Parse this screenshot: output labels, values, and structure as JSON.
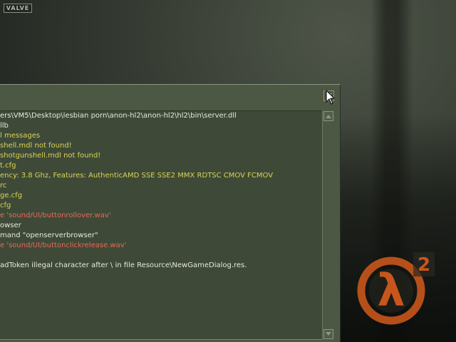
{
  "branding": {
    "valve_text": "VALVE"
  },
  "colors": {
    "white": "#e7e8df",
    "yellow": "#d8d356",
    "red": "#e46a5a",
    "logo_orange": "#c8561c"
  },
  "console": {
    "lines": [
      {
        "text": "ers\\VM5\\Desktop\\lesbian porn\\anon-hl2\\anon-hl2\\hl2\\bin\\server.dll",
        "color": "#e7e8df"
      },
      {
        "text": "llb",
        "color": "#e7e8df"
      },
      {
        "text": "l messages",
        "color": "#d8d356"
      },
      {
        "text": "shell.mdl not found!",
        "color": "#d8d356"
      },
      {
        "text": "shotgunshell.mdl not found!",
        "color": "#d8d356"
      },
      {
        "text": "t.cfg",
        "color": "#d8d356"
      },
      {
        "text": "ency: 3.8 Ghz,  Features: AuthenticAMD SSE SSE2 MMX RDTSC CMOV FCMOV",
        "color": "#d8d356"
      },
      {
        "text": "rc",
        "color": "#d8d356"
      },
      {
        "text": "ge.cfg",
        "color": "#d8d356"
      },
      {
        "text": "cfg",
        "color": "#d8d356"
      },
      {
        "text": "e 'sound/UI/buttonrollover.wav'",
        "color": "#e46a5a"
      },
      {
        "text": "owser",
        "color": "#e7e8df"
      },
      {
        "text": "mand \"openserverbrowser\"",
        "color": "#e7e8df"
      },
      {
        "text": "e 'sound/UI/buttonclickrelease.wav'",
        "color": "#e46a5a"
      },
      {
        "text": "",
        "color": "#e7e8df"
      },
      {
        "text": "adToken illegal character after \\ in file Resource\\NewGameDialog.res.",
        "color": "#e7e8df"
      }
    ]
  },
  "hl2_logo": {
    "lambda": "λ",
    "number": "2"
  },
  "icons": {
    "close": "close-icon",
    "scroll_up": "up-arrow-icon",
    "scroll_down": "down-arrow-icon",
    "cursor": "mouse-pointer-icon"
  }
}
